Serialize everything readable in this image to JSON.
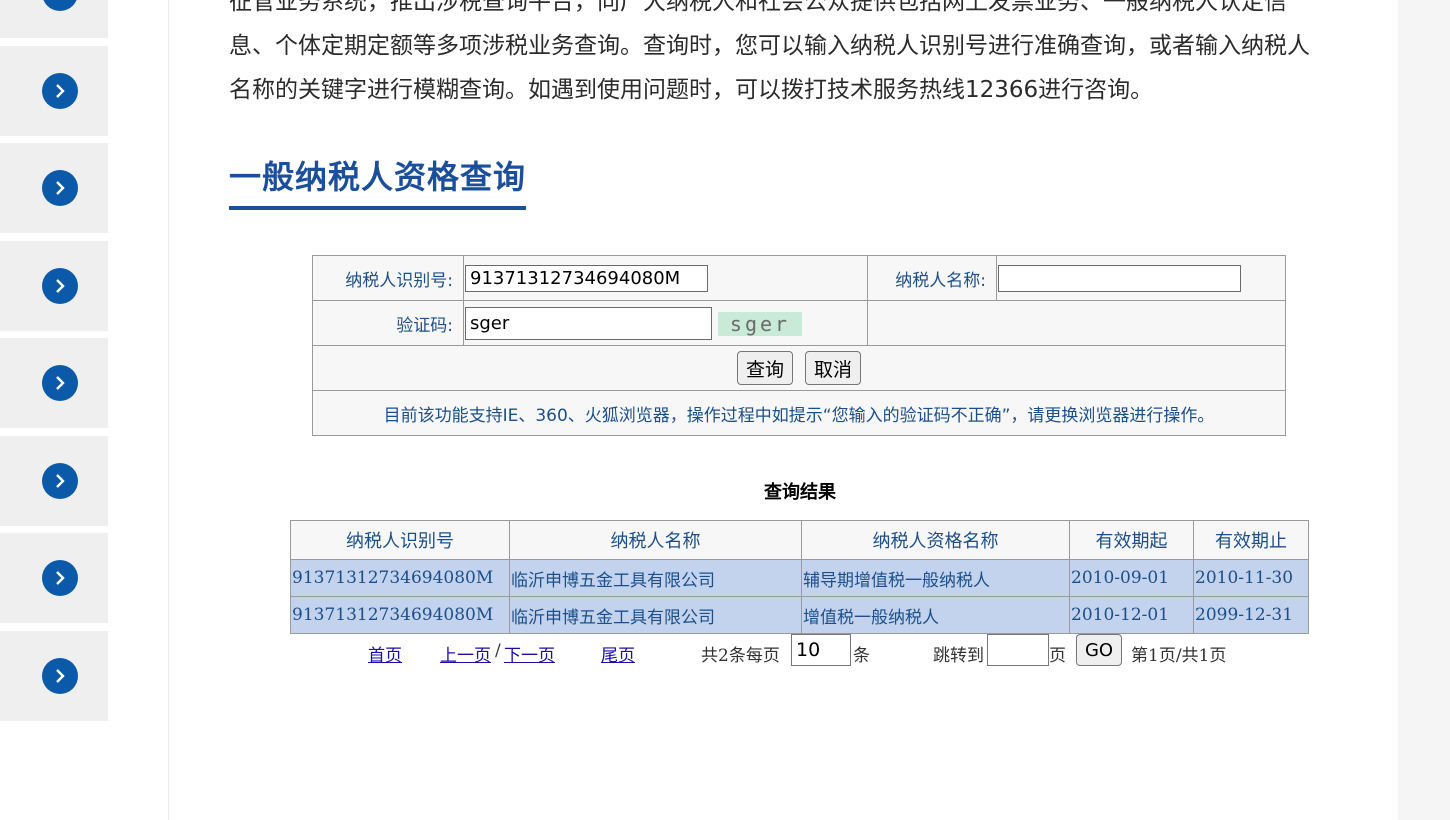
{
  "intro": {
    "line1": "征管业务系统，推出涉税查询平台，向广大纳税人和社会公众提供包括网上发票业务、一般纳税人认定信",
    "line2": "息、个体定期定额等多项涉税业务查询。查询时，您可以输入纳税人识别号进行准确查询，或者输入纳税人",
    "line3": "名称的关键字进行模糊查询。如遇到使用问题时，可以拨打技术服务热线12366进行咨询。"
  },
  "section_title": "一般纳税人资格查询",
  "form": {
    "taxpayer_id_label": "纳税人识别号:",
    "taxpayer_id_value": "91371312734694080M",
    "taxpayer_name_label": "纳税人名称:",
    "taxpayer_name_value": "",
    "captcha_label": "验证码:",
    "captcha_value": "sger",
    "captcha_image_text": "sger",
    "query_button": "查询",
    "cancel_button": "取消",
    "notice": "目前该功能支持IE、360、火狐浏览器，操作过程中如提示“您输入的验证码不正确”，请更换浏览器进行操作。"
  },
  "results": {
    "title": "查询结果",
    "columns": [
      "纳税人识别号",
      "纳税人名称",
      "纳税人资格名称",
      "有效期起",
      "有效期止"
    ],
    "rows": [
      [
        "91371312734694080M",
        "临沂申博五金工具有限公司",
        "辅导期增值税一般纳税人",
        "2010-09-01",
        "2010-11-30"
      ],
      [
        "91371312734694080M",
        "临沂申博五金工具有限公司",
        "增值税一般纳税人",
        "2010-12-01",
        "2099-12-31"
      ]
    ]
  },
  "pager": {
    "first": "首页",
    "prev": "上一页",
    "sep": "/",
    "next": "下一页",
    "last": "尾页",
    "total_prefix": "共2条每页",
    "page_size": "10",
    "unit": "条",
    "jump_label": "跳转到",
    "jump_value": "",
    "page_unit": "页",
    "go": "GO",
    "page_info": "第1页/共1页"
  },
  "sidebar": {
    "item_count": 8,
    "icon": "chevron-right-icon",
    "accent_color": "#0b5aaa"
  }
}
